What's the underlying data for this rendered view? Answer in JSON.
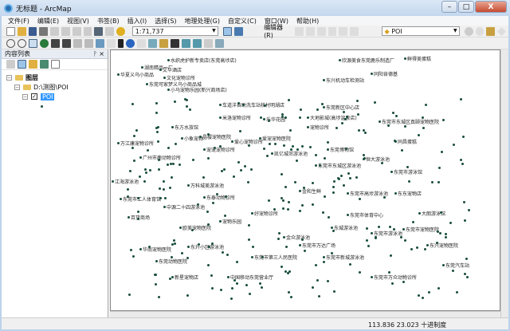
{
  "window": {
    "title": "无标题 - ArcMap",
    "min": "–",
    "max": "□",
    "close": "X"
  },
  "menu": [
    "文件(F)",
    "编辑(E)",
    "视图(V)",
    "书签(B)",
    "插入(I)",
    "选择(S)",
    "地理处理(G)",
    "自定义(C)",
    "窗口(W)",
    "帮助(H)"
  ],
  "toolbar": {
    "scale": "1:71,737",
    "editor": "编辑器(R)",
    "layer": "POI"
  },
  "toc": {
    "title": "内容列表",
    "pin": "ᚹ",
    "close": "×",
    "root": "图层",
    "folder": "D:\\测图\\POI",
    "layer": "POI"
  },
  "status": {
    "coords": "113.836  23.023 十进制度"
  },
  "map_labels": [
    "水织虎护新专卖店(东莞高埗店)",
    "华夏义乌小商品",
    "湖南精品一厂",
    "文华酒店",
    "文化宠物诊所",
    "东莞可家梦义乌小商品城",
    "小马宠物乐园(新兴商场店)",
    "欣源美食东莞鹿乐制造厂",
    "鲜得美蛋糕",
    "同阳肯德基",
    "东兴机动车检测站",
    "车道洋自助洗车站核村明湖店",
    "东莞新区中心店",
    "大地影城(高埗温泉店)",
    "米洛宠物诊所",
    "乐华花园",
    "东莞市东城区真颐宠物医院",
    "同昌蛋糕",
    "东方水族馆",
    "小象宠物",
    "万江康宠物诊所",
    "晶樱宠物医院",
    "爱心宠物诊所",
    "爱宠宠物医院",
    "宠物诊所",
    "凯亿城郊游泳池",
    "东莞博物馆",
    "宠宠宠物诊所",
    "东莞市东城区游泳池",
    "广州市鹿动物诊所",
    "恒大游泳池",
    "东莞市游泳馆",
    "江海游泳池",
    "万科城美游泳池",
    "东莞市工人体育馆",
    "东泰动物诊所",
    "中源二十四游泳池",
    "金和生鲜",
    "东莞市高埗游泳池",
    "百货商场",
    "好宠物诊所",
    "东莞市体育中心",
    "宠物乐园",
    "欧美宠物医院",
    "东城游泳池",
    "金众游泳池",
    "东东宠物店",
    "东莞市万达广场",
    "东莞市第三人民医院",
    "东莞动物医院",
    "东升小区游泳池",
    "东莞汽车站",
    "东莞市宠物医院",
    "华南宠物医院",
    "中国移动东莞营业厅",
    "东莞市新城游泳池",
    "大朗游泳馆",
    "东莞市游泳池",
    "东兴宠物医院",
    "新星宠物店",
    "东莞市万众动物诊所"
  ]
}
